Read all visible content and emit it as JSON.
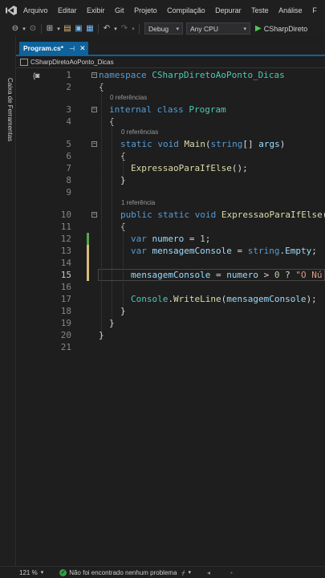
{
  "menu": {
    "items": [
      "Arquivo",
      "Editar",
      "Exibir",
      "Git",
      "Projeto",
      "Compilação",
      "Depurar",
      "Teste",
      "Análise",
      "F"
    ]
  },
  "toolbar": {
    "configuration": "Debug",
    "platform": "Any CPU",
    "start_label": "CSharpDireto"
  },
  "sidebar": {
    "toolbox_label": "Caixa de Ferramentas"
  },
  "tab": {
    "title": "Program.cs*",
    "pin_icon": "pin-icon",
    "close_icon": "close-icon"
  },
  "navbar": {
    "scope": "CSharpDiretoAoPonto_Dicas"
  },
  "editor": {
    "current_line": 15,
    "lines": [
      {
        "n": "1",
        "tokens": [
          [
            "kw",
            "namespace"
          ],
          [
            "pl",
            " "
          ],
          [
            "ty",
            "CSharpDiretoAoPonto_Dicas"
          ]
        ]
      },
      {
        "n": "2",
        "tokens": [
          [
            "pl",
            "{"
          ]
        ]
      },
      {
        "n": "3",
        "ref": "0 referências",
        "tokens": [
          [
            "kw",
            "internal"
          ],
          [
            "pl",
            " "
          ],
          [
            "kw",
            "class"
          ],
          [
            "pl",
            " "
          ],
          [
            "ty",
            "Program"
          ]
        ]
      },
      {
        "n": "4",
        "tokens": [
          [
            "pl",
            "{"
          ]
        ]
      },
      {
        "n": "5",
        "ref": "0 referências",
        "tokens": [
          [
            "kw",
            "static"
          ],
          [
            "pl",
            " "
          ],
          [
            "kw",
            "void"
          ],
          [
            "pl",
            " "
          ],
          [
            "fn",
            "Main"
          ],
          [
            "pl",
            "("
          ],
          [
            "kw",
            "string"
          ],
          [
            "pl",
            "[] "
          ],
          [
            "var",
            "args"
          ],
          [
            "pl",
            ")"
          ]
        ]
      },
      {
        "n": "6",
        "tokens": [
          [
            "pl",
            "{"
          ]
        ]
      },
      {
        "n": "7",
        "tokens": [
          [
            "fn",
            "ExpressaoParaIfElse"
          ],
          [
            "pl",
            "();"
          ]
        ]
      },
      {
        "n": "8",
        "tokens": [
          [
            "pl",
            "}"
          ]
        ]
      },
      {
        "n": "9",
        "tokens": []
      },
      {
        "n": "10",
        "ref": "1 referência",
        "tokens": [
          [
            "kw",
            "public"
          ],
          [
            "pl",
            " "
          ],
          [
            "kw",
            "static"
          ],
          [
            "pl",
            " "
          ],
          [
            "kw",
            "void"
          ],
          [
            "pl",
            " "
          ],
          [
            "fn",
            "ExpressaoParaIfElse"
          ],
          [
            "pl",
            "()"
          ]
        ]
      },
      {
        "n": "11",
        "tokens": [
          [
            "pl",
            "{"
          ]
        ]
      },
      {
        "n": "12",
        "tokens": [
          [
            "kw",
            "var"
          ],
          [
            "pl",
            " "
          ],
          [
            "var",
            "numero"
          ],
          [
            "pl",
            " = "
          ],
          [
            "num",
            "1"
          ],
          [
            "pl",
            ";"
          ]
        ]
      },
      {
        "n": "13",
        "tokens": [
          [
            "kw",
            "var"
          ],
          [
            "pl",
            " "
          ],
          [
            "var",
            "mensagemConsole"
          ],
          [
            "pl",
            " = "
          ],
          [
            "kw",
            "string"
          ],
          [
            "pl",
            "."
          ],
          [
            "var",
            "Empty"
          ],
          [
            "pl",
            ";"
          ]
        ]
      },
      {
        "n": "14",
        "tokens": []
      },
      {
        "n": "15",
        "tokens": [
          [
            "var",
            "mensagemConsole"
          ],
          [
            "pl",
            " = "
          ],
          [
            "var",
            "numero"
          ],
          [
            "pl",
            " > "
          ],
          [
            "num",
            "0"
          ],
          [
            "pl",
            " ? "
          ],
          [
            "str",
            "\"O Nú"
          ]
        ]
      },
      {
        "n": "16",
        "tokens": []
      },
      {
        "n": "17",
        "tokens": [
          [
            "ty",
            "Console"
          ],
          [
            "pl",
            "."
          ],
          [
            "fn",
            "WriteLine"
          ],
          [
            "pl",
            "("
          ],
          [
            "var",
            "mensagemConsole"
          ],
          [
            "pl",
            ");"
          ]
        ]
      },
      {
        "n": "18",
        "tokens": [
          [
            "pl",
            "}"
          ]
        ]
      },
      {
        "n": "19",
        "tokens": [
          [
            "pl",
            "}"
          ]
        ]
      },
      {
        "n": "20",
        "tokens": [
          [
            "pl",
            "}"
          ]
        ]
      },
      {
        "n": "21",
        "tokens": []
      }
    ]
  },
  "status": {
    "zoom": "121 %",
    "issues": "Não foi encontrado nenhum problema"
  },
  "colors": {
    "keyword": "#569cd6",
    "type": "#4ec9b0",
    "method": "#dcdcaa",
    "variable": "#9cdcfe",
    "number": "#b5cea8",
    "string": "#d69d85",
    "accent": "#0e639c",
    "saved_change": "#57a64a",
    "unsaved_change": "#d7ba7d"
  }
}
